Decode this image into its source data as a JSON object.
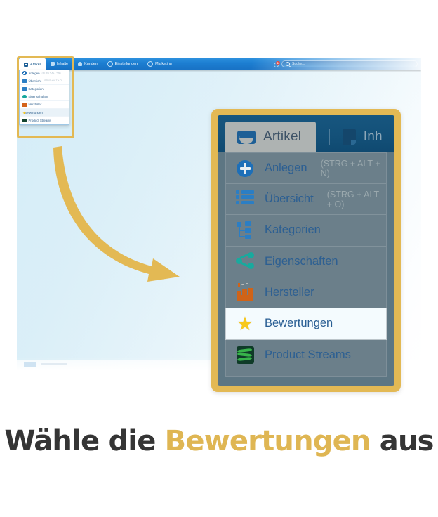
{
  "caption": {
    "prefix": "Wähle die",
    "highlight": "Bewertungen",
    "suffix": "aus",
    "highlight_color": "#dfb653",
    "base_color": "#353535"
  },
  "screenshot": {
    "background_gradient_from": "#d4ecf7",
    "background_gradient_to": "#ffffff",
    "top_nav": {
      "background_color": "#1d7fd2",
      "tabs": [
        {
          "label": "Artikel",
          "icon": "inbox-icon",
          "active": true
        },
        {
          "label": "Inhalte",
          "icon": "document-icon",
          "active": false
        },
        {
          "label": "Kunden",
          "icon": "users-icon",
          "active": false
        },
        {
          "label": "Einstellungen",
          "icon": "gear-icon",
          "active": false
        },
        {
          "label": "Marketing",
          "icon": "refresh-icon",
          "active": false
        }
      ],
      "notification": {
        "icon": "bell-icon",
        "count": "1",
        "badge_color": "#e02b20"
      },
      "search": {
        "icon": "search-icon",
        "placeholder": "Suche...",
        "value": ""
      }
    },
    "dropdown_menu": {
      "items": [
        {
          "label": "Anlegen",
          "hint": "(STRG + ALT + N)",
          "icon": "plus-circle-icon",
          "selected": false
        },
        {
          "label": "Übersicht",
          "hint": "(STRG + ALT + O)",
          "icon": "list-icon",
          "selected": false
        },
        {
          "label": "Kategorien",
          "hint": "",
          "icon": "sitemap-icon",
          "selected": false
        },
        {
          "label": "Eigenschaften",
          "hint": "",
          "icon": "share-icon",
          "selected": false
        },
        {
          "label": "Hersteller",
          "hint": "",
          "icon": "factory-icon",
          "selected": false
        },
        {
          "label": "Bewertungen",
          "hint": "",
          "icon": "star-icon",
          "selected": true
        },
        {
          "label": "Product Streams",
          "hint": "",
          "icon": "stream-icon",
          "selected": false
        }
      ]
    }
  },
  "callout": {
    "border_color": "#e3b954",
    "panel_color": "#5d7683",
    "topbar_color": "#135078",
    "active_tab": {
      "label": "Artikel",
      "icon": "inbox-icon"
    },
    "next_tab": {
      "label": "Inh",
      "icon": "document-icon"
    },
    "menu_items": [
      {
        "label": "Anlegen",
        "hint": "(STRG + ALT + N)",
        "icon": "plus-circle-icon",
        "selected": false
      },
      {
        "label": "Übersicht",
        "hint": "(STRG + ALT + O)",
        "icon": "list-icon",
        "selected": false
      },
      {
        "label": "Kategorien",
        "hint": "",
        "icon": "sitemap-icon",
        "selected": false
      },
      {
        "label": "Eigenschaften",
        "hint": "",
        "icon": "share-icon",
        "selected": false
      },
      {
        "label": "Hersteller",
        "hint": "",
        "icon": "factory-icon",
        "selected": false
      },
      {
        "label": "Bewertungen",
        "hint": "",
        "icon": "star-icon",
        "selected": true
      },
      {
        "label": "Product Streams",
        "hint": "",
        "icon": "stream-icon",
        "selected": false
      }
    ]
  },
  "arrow": {
    "color": "#e3b954",
    "direction": "curved-down-right",
    "points_to": "callout"
  }
}
